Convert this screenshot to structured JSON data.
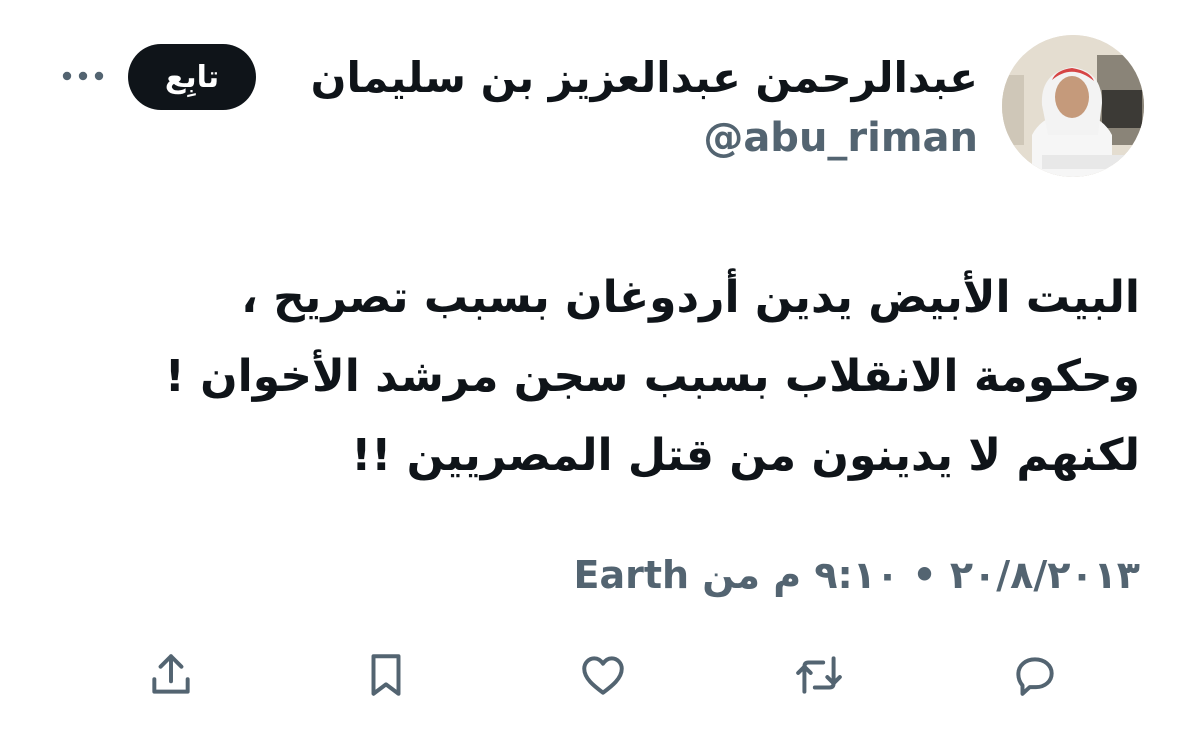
{
  "author": {
    "display_name": "عبدالرحمن عبدالعزيز بن سليمان",
    "handle": "@abu_riman",
    "avatar_icon": "profile-photo"
  },
  "header": {
    "follow_label": "تابِع",
    "more_icon": "more-horizontal-icon"
  },
  "tweet": {
    "lines": [
      "البيت الأبيض يدين أردوغان بسبب تصريح ،",
      "وحكومة الانقلاب بسبب سجن مرشد الأخوان !",
      "لكنهم لا يدينون من قتل المصريين !!"
    ]
  },
  "meta": {
    "date_time": "٢٠/٨/٢٠١٣ • ٩:١٠ م من",
    "source": "Earth"
  },
  "actions": {
    "reply_icon": "reply-icon",
    "retweet_icon": "retweet-icon",
    "like_icon": "heart-icon",
    "bookmark_icon": "bookmark-icon",
    "share_icon": "share-icon"
  },
  "colors": {
    "text_primary": "#0f1419",
    "text_secondary": "#536471",
    "button_bg": "#0f1419",
    "button_text": "#ffffff"
  }
}
